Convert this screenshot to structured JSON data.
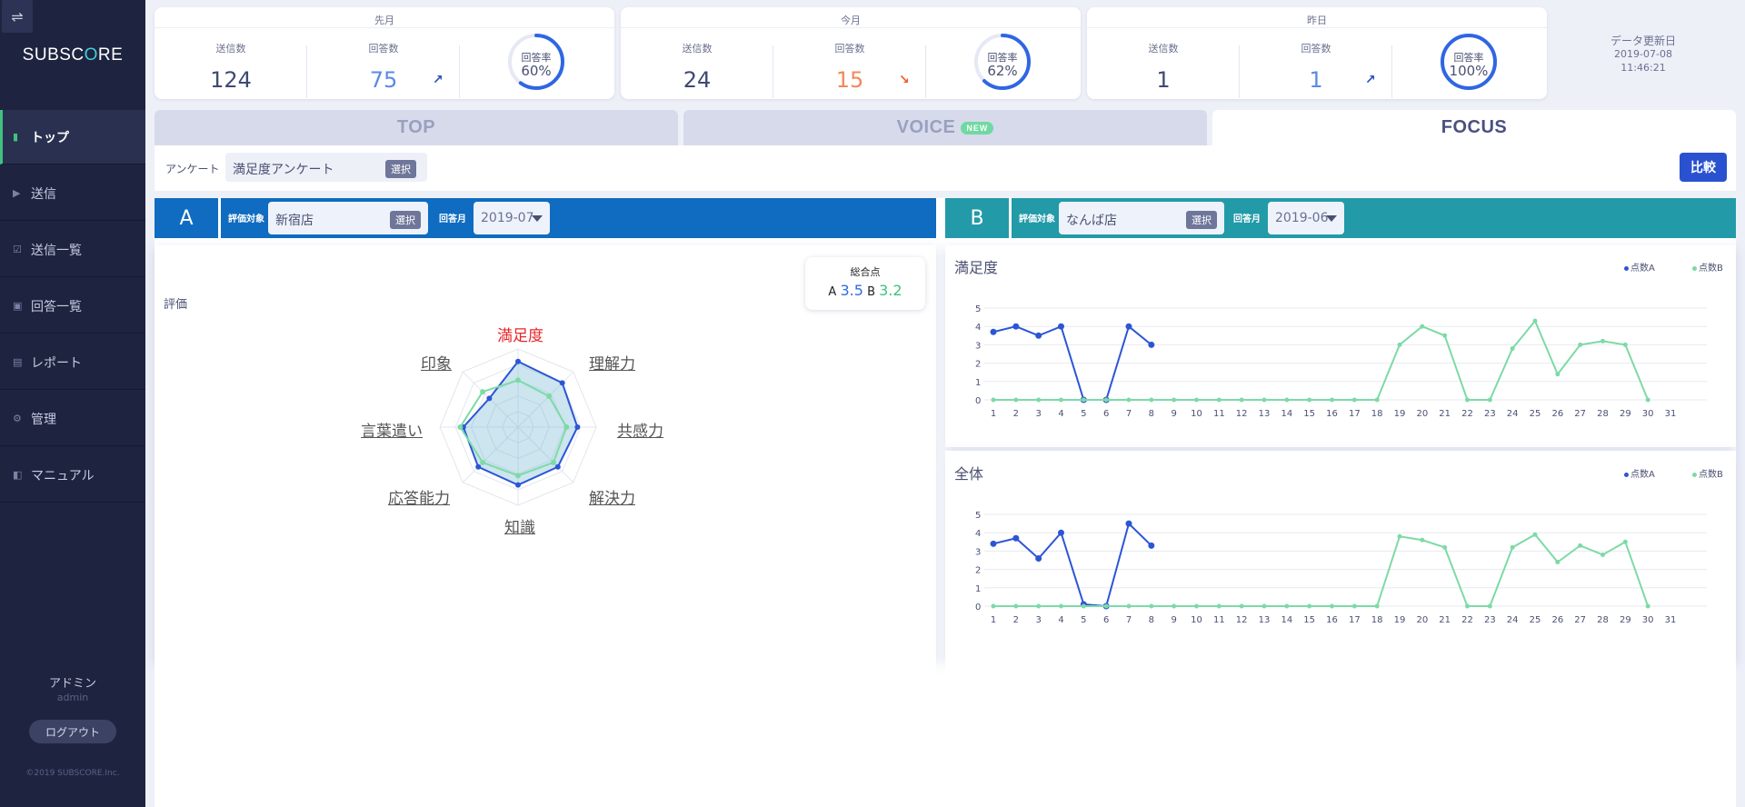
{
  "app": {
    "logo_a": "SUBSC",
    "logo_o": "O",
    "logo_b": "RE",
    "menu_icon": "sliders-icon"
  },
  "sidebar": {
    "items": [
      {
        "label": "トップ",
        "icon": "bar-chart-icon",
        "active": true
      },
      {
        "label": "送信",
        "icon": "send-icon",
        "active": false
      },
      {
        "label": "送信一覧",
        "icon": "checklist-icon",
        "active": false
      },
      {
        "label": "回答一覧",
        "icon": "inbox-icon",
        "active": false
      },
      {
        "label": "レポート",
        "icon": "report-icon",
        "active": false
      },
      {
        "label": "管理",
        "icon": "gear-icon",
        "active": false
      },
      {
        "label": "マニュアル",
        "icon": "book-icon",
        "active": false
      }
    ],
    "user_name": "アドミン",
    "user_id": "admin",
    "logout": "ログアウト",
    "copyright": "©2019 SUBSCORE.Inc."
  },
  "stats": [
    {
      "title": "先月",
      "sent_label": "送信数",
      "sent": "124",
      "answer_label": "回答数",
      "answers": "75",
      "answer_tone": "up",
      "trend": "up",
      "rate_label": "回答率",
      "rate": "60%",
      "rate_value": 60
    },
    {
      "title": "今月",
      "sent_label": "送信数",
      "sent": "24",
      "answer_label": "回答数",
      "answers": "15",
      "answer_tone": "warn",
      "trend": "down",
      "rate_label": "回答率",
      "rate": "62%",
      "rate_value": 62
    },
    {
      "title": "昨日",
      "sent_label": "送信数",
      "sent": "1",
      "answer_label": "回答数",
      "answers": "1",
      "answer_tone": "up",
      "trend": "up",
      "rate_label": "回答率",
      "rate": "100%",
      "rate_value": 100
    }
  ],
  "update": {
    "label": "データ更新日",
    "date": "2019-07-08",
    "time": "11:46:21"
  },
  "tabs": [
    {
      "label": "TOP",
      "active": false
    },
    {
      "label": "VOICE",
      "badge": "NEW",
      "active": false
    },
    {
      "label": "FOCUS",
      "active": true
    }
  ],
  "survey": {
    "label": "アンケート",
    "value": "満足度アンケート",
    "select": "選択",
    "compare": "比較"
  },
  "filters": {
    "a": {
      "letter": "A",
      "target_label": "評価対象",
      "target": "新宿店",
      "select": "選択",
      "month_label": "回答月",
      "month": "2019-07",
      "color": "#0f6cc0"
    },
    "b": {
      "letter": "B",
      "target_label": "評価対象",
      "target": "なんば店",
      "select": "選択",
      "month_label": "回答月",
      "month": "2019-06",
      "color": "#239aa8"
    }
  },
  "radar": {
    "title": "評価",
    "total_label": "総合点",
    "total_a_label": "A",
    "total_a": "3.5",
    "total_b_label": "B",
    "total_b": "3.2",
    "axes": [
      "満足度",
      "理解力",
      "共感力",
      "解決力",
      "知識",
      "応答能力",
      "言葉遣い",
      "印象"
    ],
    "series_a": [
      4.2,
      4.0,
      3.8,
      3.6,
      3.7,
      3.6,
      3.5,
      2.6
    ],
    "series_b": [
      3.0,
      2.8,
      3.1,
      3.2,
      3.1,
      3.2,
      3.7,
      3.2
    ],
    "max": 5,
    "color_a": "#2c55d6",
    "color_b": "#7ddaa6"
  },
  "legend": {
    "a": "点数A",
    "b": "点数B"
  },
  "chart_data": [
    {
      "type": "line",
      "title": "満足度",
      "x": [
        "1",
        "2",
        "3",
        "4",
        "5",
        "6",
        "7",
        "8",
        "9",
        "10",
        "11",
        "12",
        "13",
        "14",
        "15",
        "16",
        "17",
        "18",
        "19",
        "20",
        "21",
        "22",
        "23",
        "24",
        "25",
        "26",
        "27",
        "28",
        "29",
        "30",
        "31"
      ],
      "ylim": [
        0,
        5
      ],
      "yticks": [
        "0",
        "1",
        "2",
        "3",
        "4",
        "5"
      ],
      "series": [
        {
          "name": "点数A",
          "color": "#2c55d6",
          "values": [
            3.7,
            4.0,
            3.5,
            4.0,
            0,
            0,
            4.0,
            3.0
          ]
        },
        {
          "name": "点数B",
          "color": "#7ddaa6",
          "values": [
            0,
            0,
            0,
            0,
            0,
            0,
            0,
            0,
            0,
            0,
            0,
            0,
            0,
            0,
            0,
            0,
            0,
            0,
            3.0,
            4.0,
            3.5,
            0,
            0,
            2.8,
            4.3,
            1.4,
            3.0,
            3.2,
            3.0,
            0
          ]
        }
      ]
    },
    {
      "type": "line",
      "title": "全体",
      "x": [
        "1",
        "2",
        "3",
        "4",
        "5",
        "6",
        "7",
        "8",
        "9",
        "10",
        "11",
        "12",
        "13",
        "14",
        "15",
        "16",
        "17",
        "18",
        "19",
        "20",
        "21",
        "22",
        "23",
        "24",
        "25",
        "26",
        "27",
        "28",
        "29",
        "30",
        "31"
      ],
      "ylim": [
        0,
        5
      ],
      "yticks": [
        "0",
        "1",
        "2",
        "3",
        "4",
        "5"
      ],
      "series": [
        {
          "name": "点数A",
          "color": "#2c55d6",
          "values": [
            3.4,
            3.7,
            2.6,
            4.0,
            0.1,
            0,
            4.5,
            3.3
          ]
        },
        {
          "name": "点数B",
          "color": "#7ddaa6",
          "values": [
            0,
            0,
            0,
            0,
            0,
            0,
            0,
            0,
            0,
            0,
            0,
            0,
            0,
            0,
            0,
            0,
            0,
            0,
            3.8,
            3.6,
            3.2,
            0,
            0,
            3.2,
            3.9,
            2.4,
            3.3,
            2.8,
            3.5,
            0
          ]
        }
      ]
    }
  ]
}
